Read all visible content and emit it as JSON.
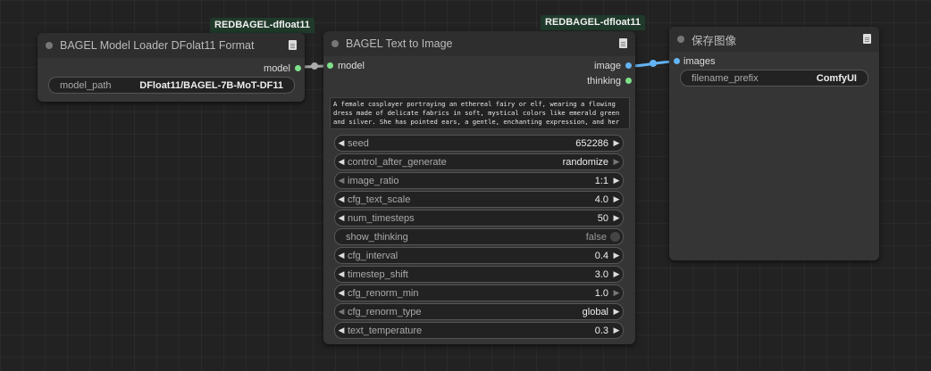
{
  "nodes": {
    "loader": {
      "badge": "REDBAGEL-dfloat11",
      "title": "BAGEL Model Loader DFolat11 Format",
      "output_label": "model",
      "widget": {
        "label": "model_path",
        "value": "DFloat11/BAGEL-7B-MoT-DF11"
      }
    },
    "t2i": {
      "badge": "REDBAGEL-dfloat11",
      "title": "BAGEL Text to Image",
      "input_label": "model",
      "output_image_label": "image",
      "output_thinking_label": "thinking",
      "prompt": "A female cosplayer portraying an ethereal fairy or elf, wearing a flowing dress made of delicate fabrics in soft, mystical colors like emerald green and silver. She has pointed ears, a gentle, enchanting expression, and her",
      "widgets": [
        {
          "label": "seed",
          "value": "652286"
        },
        {
          "label": "control_after_generate",
          "value": "randomize"
        },
        {
          "label": "image_ratio",
          "value": "1:1"
        },
        {
          "label": "cfg_text_scale",
          "value": "4.0"
        },
        {
          "label": "num_timesteps",
          "value": "50"
        },
        {
          "label": "show_thinking",
          "value": "false"
        },
        {
          "label": "cfg_interval",
          "value": "0.4"
        },
        {
          "label": "timestep_shift",
          "value": "3.0"
        },
        {
          "label": "cfg_renorm_min",
          "value": "1.0"
        },
        {
          "label": "cfg_renorm_type",
          "value": "global"
        },
        {
          "label": "text_temperature",
          "value": "0.3"
        }
      ]
    },
    "save": {
      "title": "保存图像",
      "input_label": "images",
      "widget": {
        "label": "filename_prefix",
        "value": "ComfyUI"
      }
    }
  },
  "colors": {
    "model_slot": "#7fe08a",
    "image_slot": "#64b5f6",
    "link_model": "#aaaaaa",
    "link_image": "#64b5f6"
  }
}
